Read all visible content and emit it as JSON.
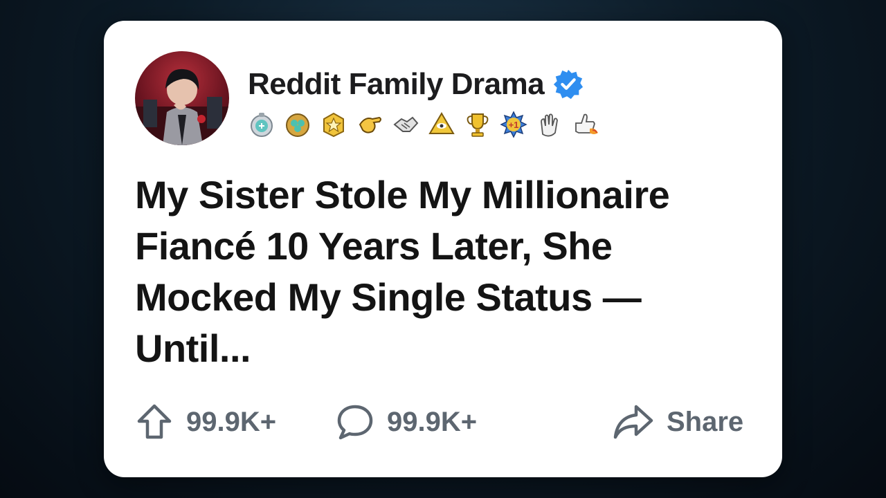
{
  "post": {
    "channel_name": "Reddit Family Drama",
    "verified_icon": "verified-check-icon",
    "title_lines": [
      "My Sister Stole My Millionaire",
      "Fiancé 10 Years Later, She",
      "Mocked My Single Status —",
      "Until..."
    ],
    "badges": [
      "silver-medal-icon",
      "clover-medal-icon",
      "gold-star-medal-icon",
      "pointing-hand-icon",
      "handshake-icon",
      "pyramid-eye-icon",
      "trophy-icon",
      "plus-one-icon",
      "clapping-hands-icon",
      "rocket-thumbs-up-icon"
    ]
  },
  "actions": {
    "upvotes": "99.9K+",
    "comments": "99.9K+",
    "share_label": "Share"
  },
  "colors": {
    "card": "#ffffff",
    "title_text": "#141414",
    "action_text": "#5d6670",
    "verified": "#2f8ef0"
  }
}
